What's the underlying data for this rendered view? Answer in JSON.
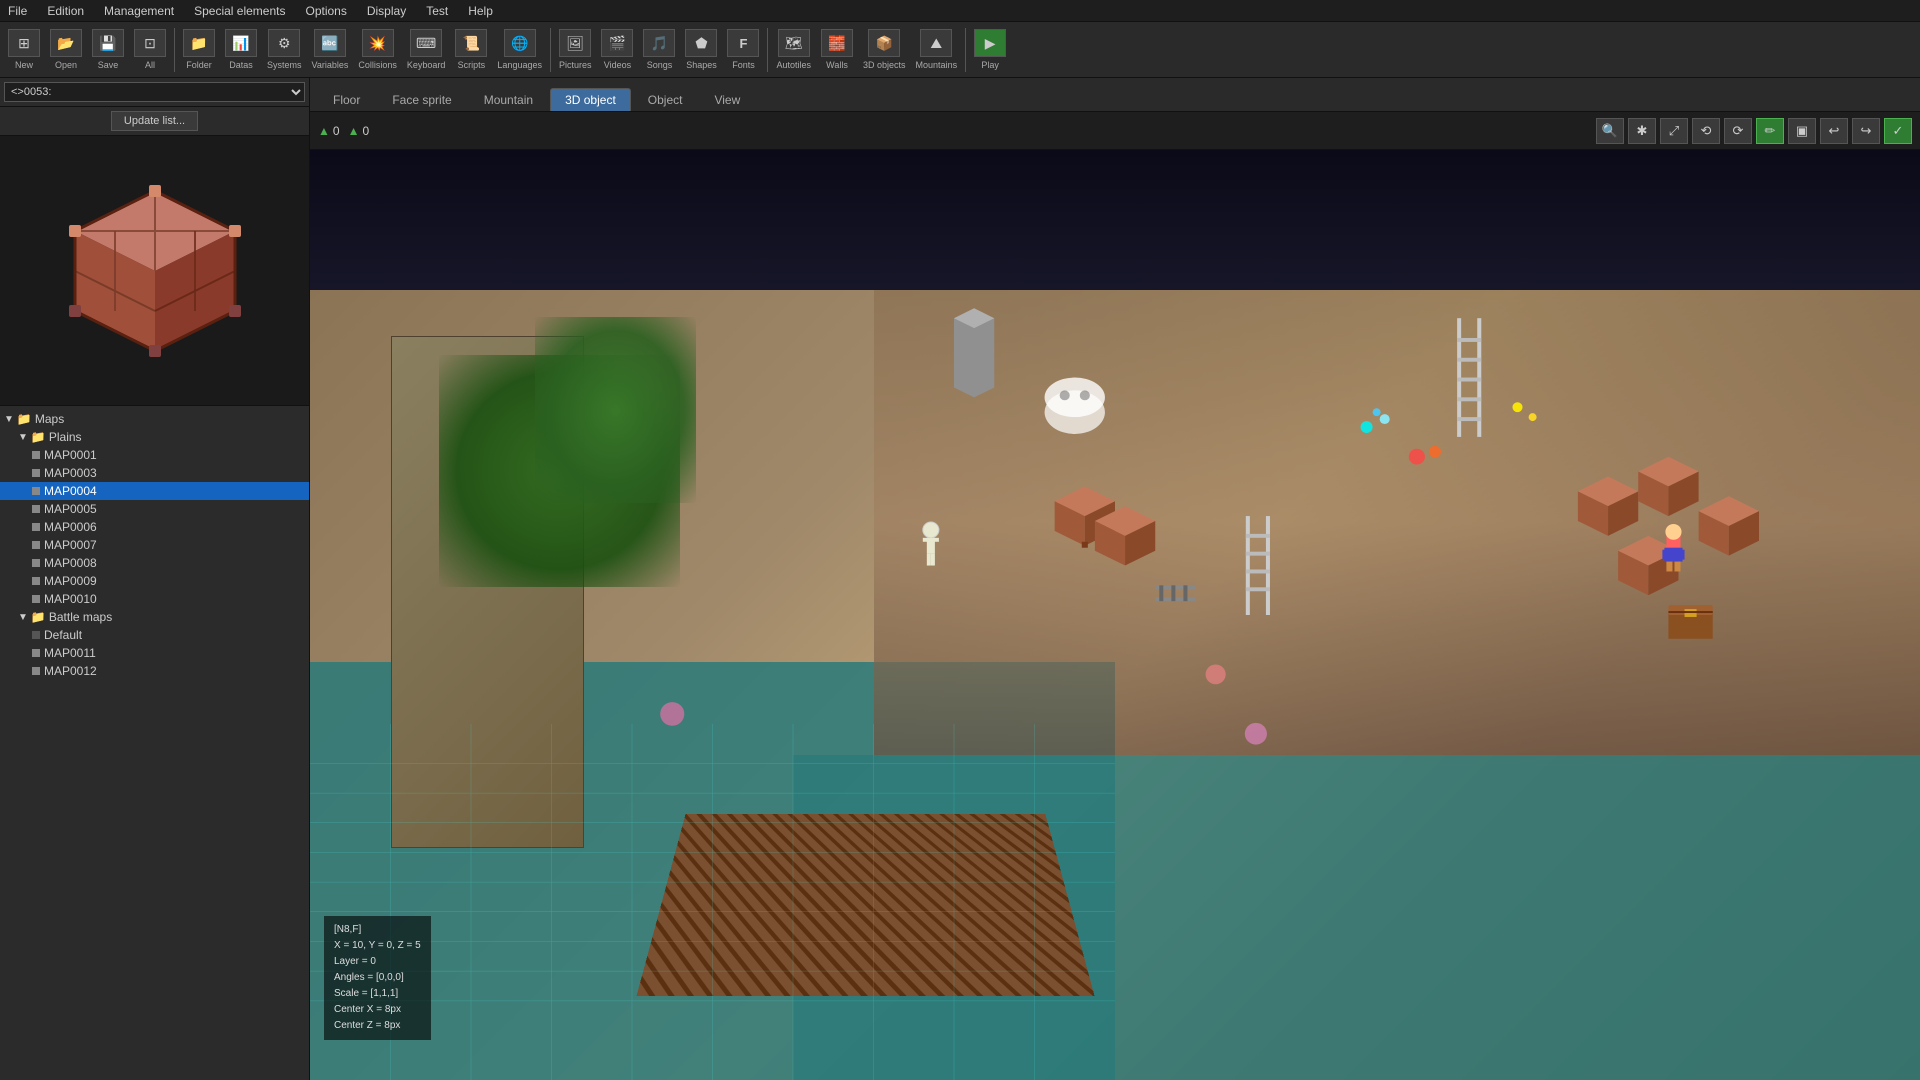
{
  "menubar": {
    "items": [
      "File",
      "Edition",
      "Management",
      "Special elements",
      "Options",
      "Display",
      "Test",
      "Help"
    ]
  },
  "toolbar": {
    "groups": [
      {
        "icon": "⊞",
        "label": "New"
      },
      {
        "icon": "📂",
        "label": "Open"
      },
      {
        "icon": "💾",
        "label": "Save"
      },
      {
        "icon": "⊡",
        "label": "All"
      },
      {
        "icon": "📁",
        "label": "Folder"
      },
      {
        "icon": "📊",
        "label": "Datas"
      },
      {
        "icon": "⚙",
        "label": "Systems"
      },
      {
        "icon": "🔤",
        "label": "Variables"
      },
      {
        "icon": "💥",
        "label": "Collisions"
      },
      {
        "icon": "⌨",
        "label": "Keyboard"
      },
      {
        "icon": "📜",
        "label": "Scripts"
      },
      {
        "icon": "🌐",
        "label": "Languages"
      },
      {
        "icon": "🖼",
        "label": "Pictures"
      },
      {
        "icon": "🎬",
        "label": "Videos"
      },
      {
        "icon": "🎵",
        "label": "Songs"
      },
      {
        "icon": "⬟",
        "label": "Shapes"
      },
      {
        "icon": "F",
        "label": "Fonts"
      },
      {
        "icon": "🗺",
        "label": "Autotiles"
      },
      {
        "icon": "🧱",
        "label": "Walls"
      },
      {
        "icon": "📦",
        "label": "3D objects"
      },
      {
        "icon": "⛰",
        "label": "Mountains"
      },
      {
        "icon": "▶",
        "label": "Play"
      }
    ]
  },
  "sidebar": {
    "dropdown_value": "<>0053:",
    "update_button": "Update list...",
    "tree": {
      "root_label": "Maps",
      "groups": [
        {
          "label": "Plains",
          "items": [
            "MAP0001",
            "MAP0003",
            "MAP0004",
            "MAP0005",
            "MAP0006",
            "MAP0007",
            "MAP0008",
            "MAP0009",
            "MAP0010"
          ]
        },
        {
          "label": "Battle maps",
          "subitems": [
            "Default"
          ],
          "items": [
            "MAP0011",
            "MAP0012"
          ]
        }
      ]
    },
    "selected_map": "MAP0004"
  },
  "tabs": [
    "Floor",
    "Face sprite",
    "Mountain",
    "3D object",
    "Object",
    "View"
  ],
  "active_tab": "3D object",
  "coord": {
    "x": "0",
    "y": "0"
  },
  "view_tools": {
    "icons": [
      "🔍",
      "✱",
      "⤢",
      "⟲",
      "⟳",
      "✏",
      "▣",
      "↩",
      "↪",
      "✓"
    ]
  },
  "info_overlay": {
    "line1": "[N8,F]",
    "line2": "X = 10, Y = 0, Z = 5",
    "line3": "Layer = 0",
    "line4": "Angles = [0,0,0]",
    "line5": "Scale = [1,1,1]",
    "line6": "Center X = 8px",
    "line7": "Center Z = 8px"
  },
  "colors": {
    "selected_tab_bg": "#3d6b9e",
    "selected_tree_bg": "#1565c0",
    "toolbar_bg": "#2a2a2a",
    "sidebar_bg": "#2b2b2b",
    "viewport_bg": "#1a1a2e",
    "active_tool_green": "#2e7d32"
  }
}
